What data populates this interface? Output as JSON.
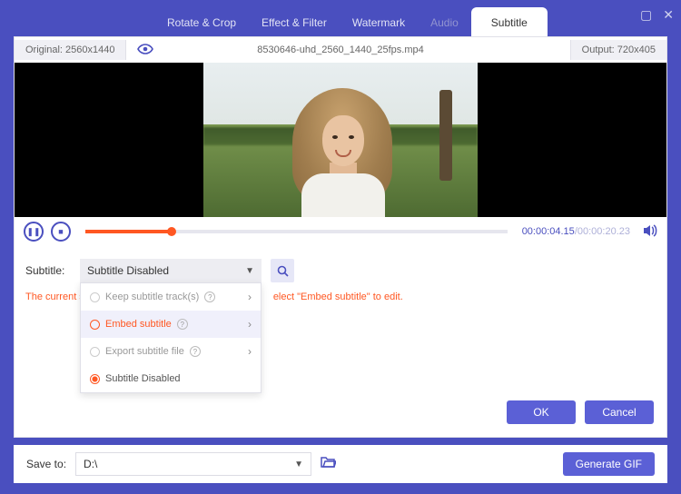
{
  "tabs": {
    "rotate": "Rotate & Crop",
    "effect": "Effect & Filter",
    "watermark": "Watermark",
    "audio": "Audio",
    "subtitle": "Subtitle"
  },
  "info": {
    "original": "Original: 2560x1440",
    "filename": "8530646-uhd_2560_1440_25fps.mp4",
    "output": "Output: 720x405"
  },
  "time": {
    "current": "00:00:04.15",
    "sep": "/",
    "duration": "00:00:20.23"
  },
  "subtitle": {
    "label": "Subtitle:",
    "selected": "Subtitle Disabled",
    "items": {
      "keep": "Keep subtitle track(s)",
      "embed": "Embed subtitle",
      "export": "Export subtitle file",
      "disabled": "Subtitle Disabled"
    }
  },
  "hint": {
    "left": "The current s",
    "right": "elect \"Embed subtitle\" to edit."
  },
  "buttons": {
    "ok": "OK",
    "cancel": "Cancel",
    "gif": "Generate GIF"
  },
  "save": {
    "label": "Save to:",
    "path": "D:\\"
  }
}
